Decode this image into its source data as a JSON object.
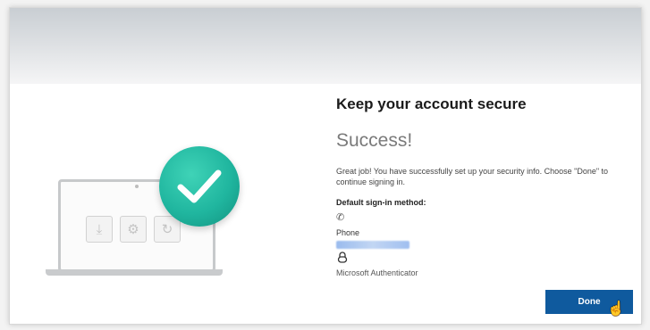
{
  "dialog": {
    "title": "Keep your account secure",
    "status": "Success!",
    "description": "Great job! You have successfully set up your security info. Choose \"Done\" to continue signing in.",
    "default_method_label": "Default sign-in method:",
    "methods": [
      {
        "icon": "phone-icon",
        "label": "Phone"
      },
      {
        "icon": "authenticator-lock-icon",
        "label": "Microsoft Authenticator"
      }
    ],
    "done_label": "Done"
  },
  "illustration": {
    "tiles": [
      "download-icon",
      "settings-icon",
      "refresh-icon"
    ],
    "badge": "check-icon"
  },
  "colors": {
    "accent": "#0f5a9e",
    "success": "#20b69f"
  }
}
